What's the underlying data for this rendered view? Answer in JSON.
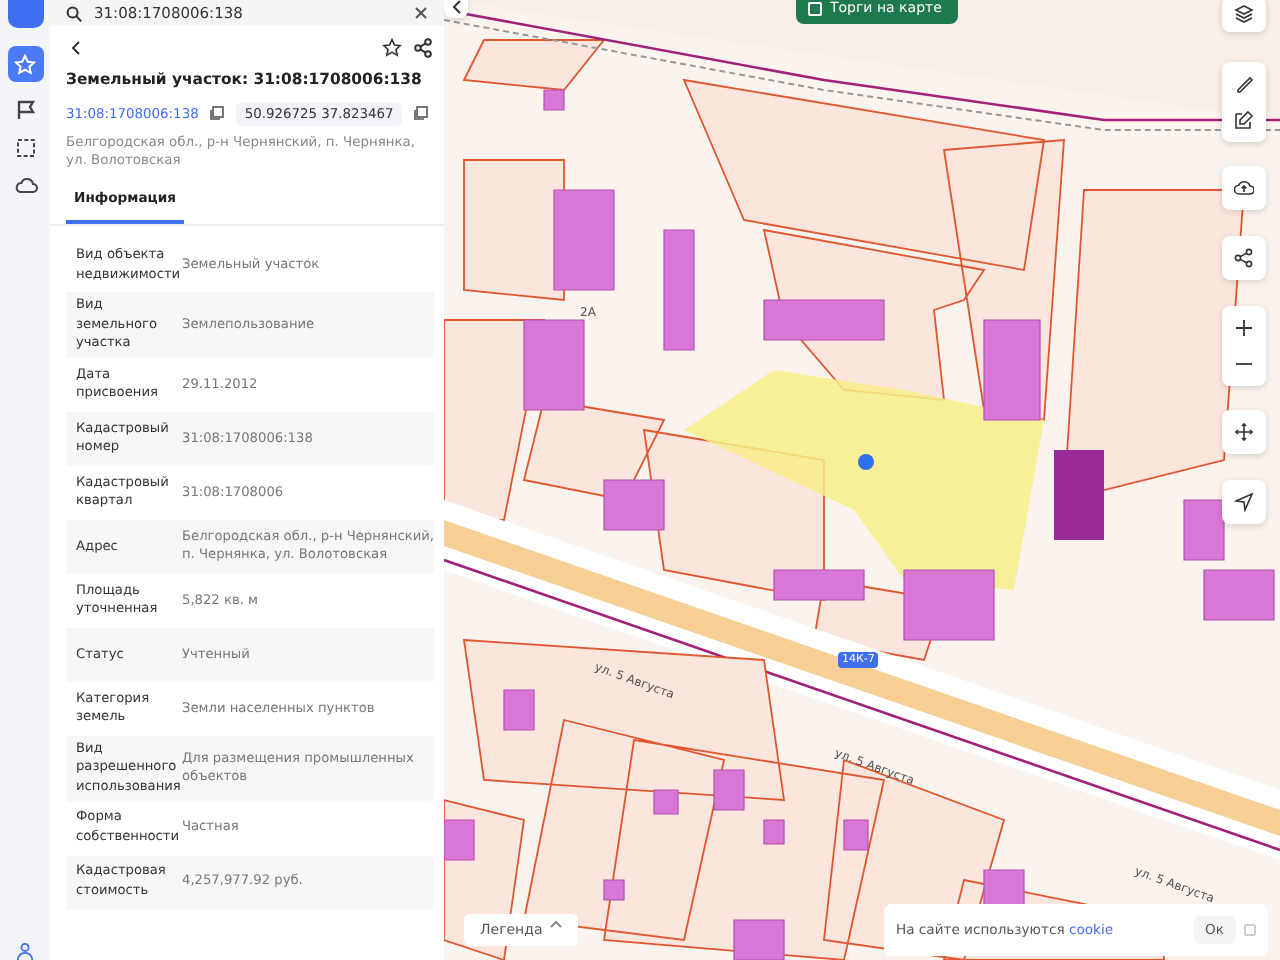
{
  "search": {
    "value": "31:08:1708006:138"
  },
  "object": {
    "title": "Земельный участок: 31:08:1708006:138",
    "cadastral_link": "31:08:1708006:138",
    "coordinates": "50.926725 37.823467",
    "address": "Белгородская обл., р-н Чернянский, п. Чернянка, ул. Волотовская"
  },
  "tabs": [
    {
      "label": "Информация",
      "selected": true
    }
  ],
  "properties": [
    {
      "label": "Вид объекта недвижимости",
      "value": "Земельный участок"
    },
    {
      "label": "Вид земельного участка",
      "value": "Землепользование"
    },
    {
      "label": "Дата присвоения",
      "value": "29.11.2012"
    },
    {
      "label": "Кадастровый номер",
      "value": "31:08:1708006:138"
    },
    {
      "label": "Кадастровый квартал",
      "value": "31:08:1708006"
    },
    {
      "label": "Адрес",
      "value": "Белгородская обл., р-н Чернянский, п. Чернянка, ул. Волотовская"
    },
    {
      "label": "Площадь уточненная",
      "value": "5,822 кв. м"
    },
    {
      "label": "Статус",
      "value": "Учтенный"
    },
    {
      "label": "Категория земель",
      "value": "Земли населенных пунктов"
    },
    {
      "label": "Вид разрешенного использования",
      "value": "Для размещения промышленных объектов"
    },
    {
      "label": "Форма собственности",
      "value": "Частная"
    },
    {
      "label": "Кадастровая стоимость",
      "value": "4,257,977.92 руб."
    }
  ],
  "map": {
    "top_button": "Торги на карте",
    "labels": [
      {
        "text": "2А"
      },
      {
        "text": "ул. 5 Августа"
      },
      {
        "text": "ул. 5 Августа"
      },
      {
        "text": "ул. 5 Августа"
      }
    ],
    "road_badge": "14К-7",
    "legend": "Легенда",
    "cookie": {
      "text": "На сайте используются",
      "link": "cookie",
      "button": "Ок"
    }
  }
}
